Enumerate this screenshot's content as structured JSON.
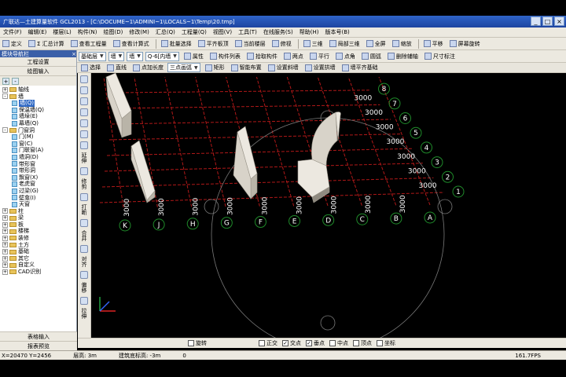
{
  "window": {
    "title": "广联达—土建算量软件 GCL2013 - [C:\\DOCUME~1\\ADMINI~1\\LOCALS~1\\Temp\\20.tmp]"
  },
  "menu": [
    "文件(F)",
    "编辑(E)",
    "楼层(L)",
    "构件(N)",
    "绘图(D)",
    "修改(M)",
    "汇总(Q)",
    "工程量(Q)",
    "视图(V)",
    "工具(T)",
    "在线服务(S)",
    "帮助(H)",
    "版本号(B)"
  ],
  "toolbar1": [
    "定义",
    "Σ 汇总计算",
    "查看工程量",
    "查看计算式",
    "批量选择",
    "平齐板顶",
    "当前楼层",
    "俯视",
    "三维",
    "局部三维",
    "全屏",
    "缩放",
    "平移",
    "屏幕旋转"
  ],
  "toolbar2": {
    "floor_combo": "基础层",
    "type_combo": "墙",
    "member_combo": "墙",
    "name_combo": "Q-6[内墙",
    "buttons": [
      "属性",
      "构件列表",
      "拾取构件",
      "两点",
      "平行",
      "点角",
      "圆弧",
      "删除辅轴",
      "尺寸标注"
    ]
  },
  "toolbar3": {
    "buttons": [
      "选择",
      "直线",
      "点加长度",
      "矩形",
      "智能布置",
      "设置斜墙",
      "设置拱墙",
      "墙平齐基础"
    ],
    "arc_combo": "三点画弧"
  },
  "panel": {
    "header": "模块导航栏",
    "btn_settings": "工程设置",
    "btn_draw": "绘图输入",
    "tree": [
      {
        "label": "轴线",
        "level": 0,
        "kind": "folder",
        "sign": "+"
      },
      {
        "label": "墙",
        "level": 0,
        "kind": "folder",
        "sign": "-"
      },
      {
        "label": "墙(Q)",
        "level": 1,
        "kind": "leaf",
        "selected": true
      },
      {
        "label": "保温墙(Q)",
        "level": 1,
        "kind": "leaf"
      },
      {
        "label": "墙垛(E)",
        "level": 1,
        "kind": "leaf"
      },
      {
        "label": "幕墙(Q)",
        "level": 1,
        "kind": "leaf"
      },
      {
        "label": "门窗洞",
        "level": 0,
        "kind": "folder",
        "sign": "-"
      },
      {
        "label": "门(M)",
        "level": 1,
        "kind": "leaf"
      },
      {
        "label": "窗(C)",
        "level": 1,
        "kind": "leaf"
      },
      {
        "label": "门联窗(A)",
        "level": 1,
        "kind": "leaf"
      },
      {
        "label": "墙洞(D)",
        "level": 1,
        "kind": "leaf"
      },
      {
        "label": "带形窗",
        "level": 1,
        "kind": "leaf"
      },
      {
        "label": "带形洞",
        "level": 1,
        "kind": "leaf"
      },
      {
        "label": "飘窗(X)",
        "level": 1,
        "kind": "leaf"
      },
      {
        "label": "老虎窗",
        "level": 1,
        "kind": "leaf"
      },
      {
        "label": "过梁(G)",
        "level": 1,
        "kind": "leaf"
      },
      {
        "label": "壁龛(I)",
        "level": 1,
        "kind": "leaf"
      },
      {
        "label": "天窗",
        "level": 1,
        "kind": "leaf"
      },
      {
        "label": "柱",
        "level": 0,
        "kind": "folder",
        "sign": "+"
      },
      {
        "label": "梁",
        "level": 0,
        "kind": "folder",
        "sign": "+"
      },
      {
        "label": "板",
        "level": 0,
        "kind": "folder",
        "sign": "+"
      },
      {
        "label": "楼梯",
        "level": 0,
        "kind": "folder",
        "sign": "+"
      },
      {
        "label": "装修",
        "level": 0,
        "kind": "folder",
        "sign": "+"
      },
      {
        "label": "土方",
        "level": 0,
        "kind": "folder",
        "sign": "+"
      },
      {
        "label": "基础",
        "level": 0,
        "kind": "folder",
        "sign": "+"
      },
      {
        "label": "其它",
        "level": 0,
        "kind": "folder",
        "sign": "+"
      },
      {
        "label": "自定义",
        "level": 0,
        "kind": "folder",
        "sign": "+"
      },
      {
        "label": "CAD识别",
        "level": 0,
        "kind": "folder",
        "sign": "+"
      }
    ],
    "btn_table": "表格输入",
    "btn_report": "报表预览"
  },
  "vtools": [
    "延伸",
    "修剪",
    "打断",
    "合并",
    "对齐",
    "偏移",
    "拉伸"
  ],
  "viewport": {
    "row_labels": [
      "1",
      "2",
      "3",
      "4",
      "5",
      "6",
      "7",
      "8"
    ],
    "row_dims": [
      "3000",
      "3000",
      "3000",
      "3000",
      "3000",
      "3000",
      "3000"
    ],
    "col_labels": [
      "A",
      "B",
      "C",
      "D",
      "E",
      "F",
      "G",
      "H",
      "J",
      "K"
    ],
    "col_dims": [
      "3000",
      "3000",
      "3000",
      "3000",
      "3000",
      "3000",
      "3000",
      "3000",
      "3000"
    ],
    "grid_color": "#b01818",
    "wall_color": "#ece8e0"
  },
  "snaps": [
    "正交",
    "交点",
    "垂点",
    "中点",
    "顶点",
    "坐标"
  ],
  "snaps_on": [
    false,
    true,
    true,
    false,
    false,
    false
  ],
  "snap_rotate": "旋转",
  "status": {
    "coords": "X=20470 Y=2456",
    "floor_height": "层高: 3m",
    "base_elev": "建筑底标高: -3m",
    "value": "0",
    "fps": "161.7FPS"
  }
}
